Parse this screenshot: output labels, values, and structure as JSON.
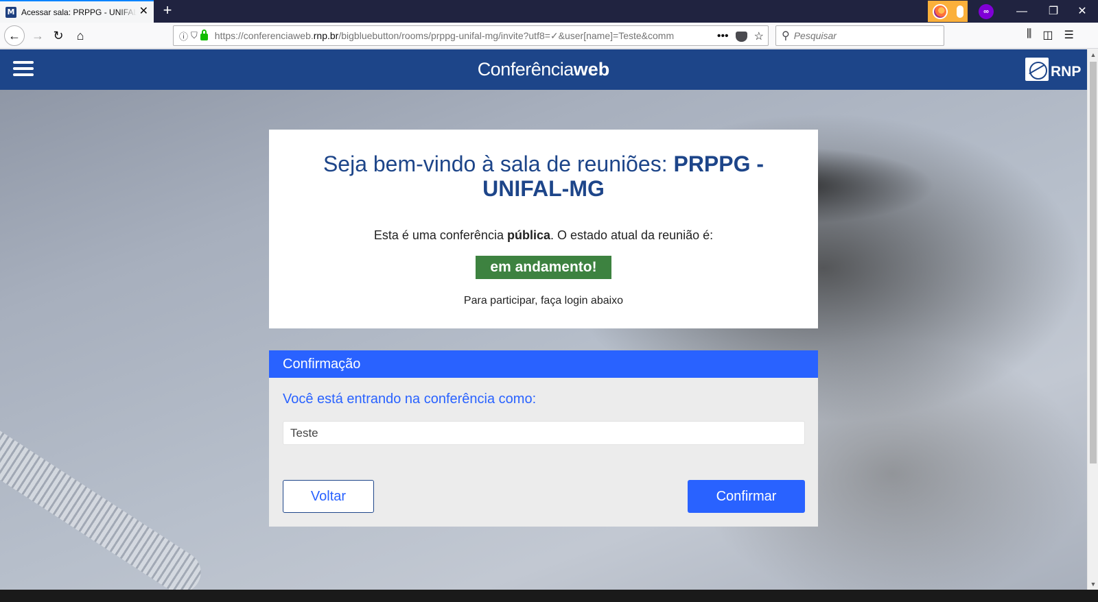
{
  "browser": {
    "tab_title": "Acessar sala: PRPPG - UNIFAL-MG",
    "tab_favicon": "M",
    "url_prefix": "https://conferenciaweb.",
    "url_domain": "rnp.br",
    "url_path": "/bigbluebutton/rooms/prppg-unifal-mg/invite?utf8=✓&user[name]=Teste&comm",
    "search_placeholder": "Pesquisar"
  },
  "icons": {
    "new_tab": "+",
    "tab_close": "✕",
    "minimize": "—",
    "restore": "❐",
    "close": "✕",
    "back": "←",
    "forward": "→",
    "reload": "↻",
    "home": "⌂",
    "info": "ⓘ",
    "tracking": "⛉",
    "more": "•••",
    "star": "☆",
    "search": "⚲",
    "library": "⫼",
    "sidebar": "◫",
    "menu": "☰",
    "mask": "∞"
  },
  "header": {
    "brand_light": "Conferência",
    "brand_bold": "web",
    "logo_text": "RNP"
  },
  "welcome": {
    "prefix": "Seja bem-vindo à sala de reuniões: ",
    "room_name": "PRPPG - UNIFAL-MG",
    "status_prefix": "Esta é uma conferência ",
    "status_bold": "pública",
    "status_suffix": ". O estado atual da reunião é:",
    "status_badge": "em andamento!",
    "login_hint": "Para participar, faça login abaixo"
  },
  "confirmation": {
    "title": "Confirmação",
    "label": "Você está entrando na conferência como:",
    "name_value": "Teste",
    "back_button": "Voltar",
    "confirm_button": "Confirmar"
  },
  "colors": {
    "header_blue": "#1d4589",
    "accent_blue": "#2962ff",
    "status_green": "#3d8240"
  }
}
